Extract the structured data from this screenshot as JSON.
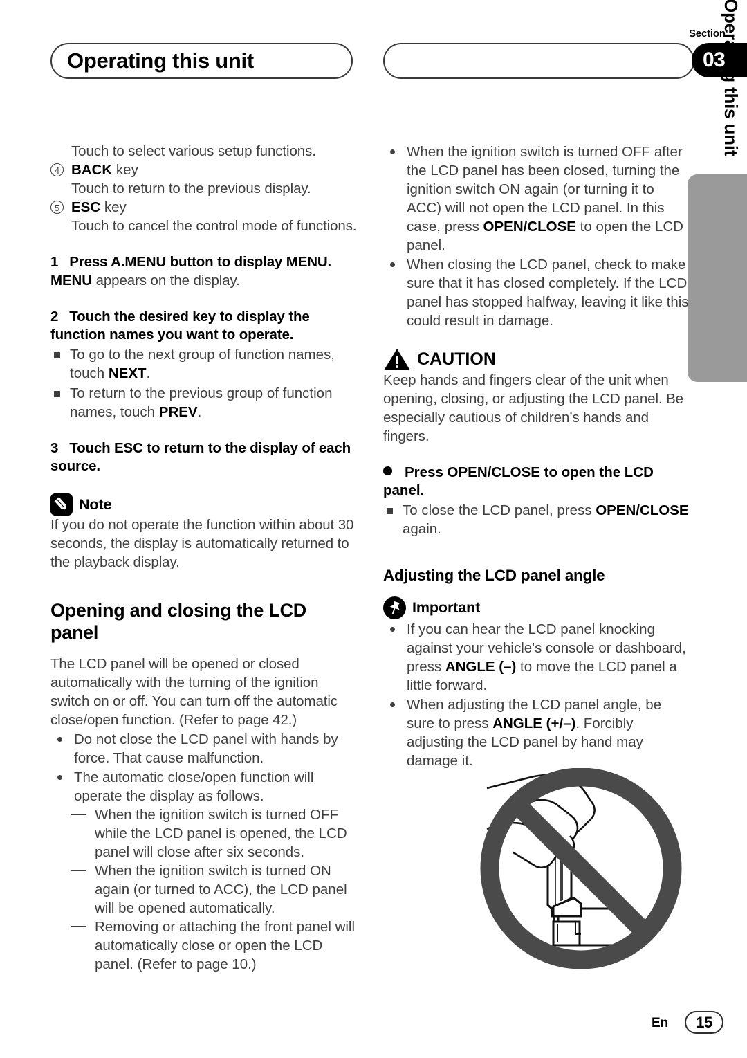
{
  "header": {
    "title": "Operating this unit",
    "section_label": "Section",
    "section_number": "03"
  },
  "side_tab": {
    "text": "Operating this unit"
  },
  "left_column": {
    "lead_line": "Touch to select various setup functions.",
    "key_items": [
      {
        "num": "4",
        "key": "BACK",
        "key_suffix": " key",
        "desc": "Touch to return to the previous display."
      },
      {
        "num": "5",
        "key": "ESC",
        "key_suffix": " key",
        "desc": "Touch to cancel the control mode of functions."
      }
    ],
    "step1": {
      "n": "1",
      "text": "Press A.MENU button to display MENU."
    },
    "step1_note_bold": "MENU",
    "step1_note_rest": " appears on the display.",
    "step2": {
      "n": "2",
      "text": "Touch the desired key to display the function names you want to operate."
    },
    "step2_subnote_1_a": "To go to the next group of function names, touch ",
    "step2_subnote_1_b": "NEXT",
    "step2_subnote_1_c": ".",
    "step2_subnote_2_a": "To return to the previous group of function names, touch ",
    "step2_subnote_2_b": "PREV",
    "step2_subnote_2_c": ".",
    "step3": {
      "n": "3",
      "text": "Touch ESC to return to the display of each source."
    },
    "note": {
      "icon": "pencil-icon",
      "label": "Note",
      "body": "If you do not operate the function within about 30 seconds, the display is automatically returned to the playback display."
    },
    "heading_opening": "Opening and closing the LCD panel",
    "opening_body": "The LCD panel will be opened or closed automatically with the turning of the ignition switch on or off. You can turn off the automatic close/open function. (Refer to page 42.)",
    "opening_bullets": [
      "Do not close the LCD panel with hands by force. That cause malfunction.",
      "The automatic close/open function will operate the display as follows."
    ],
    "opening_dashes": [
      "When the ignition switch is turned OFF while the LCD panel is opened, the LCD panel will close after six seconds.",
      "When the ignition switch is turned ON again (or turned to ACC), the LCD panel will be opened automatically.",
      "Removing or attaching the front panel will automatically close or open the LCD panel. (Refer to page 10.)"
    ]
  },
  "right_column": {
    "bullet1_a": "When the ignition switch is turned OFF after the LCD panel has been closed, turning the ignition switch ON again (or turning it to ACC) will not open the LCD panel. In this case, press ",
    "bullet1_b": "OPEN/CLOSE",
    "bullet1_c": " to open the LCD panel.",
    "bullet2": "When closing the LCD panel, check to make sure that it has closed completely. If the LCD panel has stopped halfway, leaving it like this could result in damage.",
    "caution": {
      "icon": "warning-triangle-icon",
      "label": "CAUTION",
      "body": "Keep hands and fingers clear of the unit when opening, closing, or adjusting the LCD panel. Be especially cautious of children’s hands and fingers."
    },
    "press_step": "Press OPEN/CLOSE to open the LCD panel.",
    "press_subnote_a": "To close the LCD panel, press ",
    "press_subnote_b": "OPEN/CLOSE",
    "press_subnote_c": " again.",
    "heading_adjusting": "Adjusting the LCD panel angle",
    "important": {
      "icon": "pushpin-icon",
      "label": "Important"
    },
    "important_bullet1_a": "If you can hear the LCD panel knocking against your vehicle's console or dashboard, press ",
    "important_bullet1_b": "ANGLE (–)",
    "important_bullet1_c": " to move the LCD panel a little forward.",
    "important_bullet2_a": "When adjusting the LCD panel angle, be sure to press ",
    "important_bullet2_b": "ANGLE (+/–)",
    "important_bullet2_c": ". Forcibly adjusting the LCD panel by hand may damage it.",
    "figure": {
      "name": "do-not-push-lcd-panel-by-hand-illustration",
      "prohibition_color": "#4a4a4a"
    }
  },
  "footer": {
    "language": "En",
    "page_number": "15"
  }
}
